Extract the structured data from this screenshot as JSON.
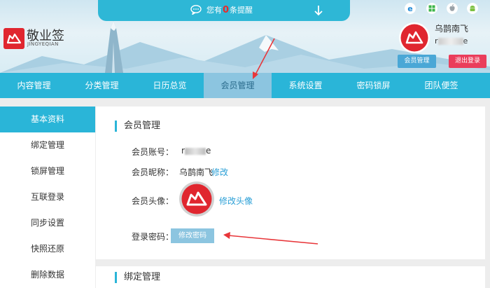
{
  "notification": {
    "prefix": "您有",
    "count": "0",
    "suffix": "条提醒"
  },
  "brand": {
    "name": "敬业签",
    "subtitle": "JINGYEQIAN"
  },
  "platforms": [
    "ie-icon",
    "windows-icon",
    "apple-icon",
    "android-icon"
  ],
  "user": {
    "nickname": "乌鹊南飞",
    "account_suffix": "e",
    "member_button": "会员管理",
    "logout_button": "退出登录"
  },
  "nav": {
    "items": [
      {
        "label": "内容管理"
      },
      {
        "label": "分类管理"
      },
      {
        "label": "日历总览"
      },
      {
        "label": "会员管理"
      },
      {
        "label": "系统设置"
      },
      {
        "label": "密码锁屏"
      },
      {
        "label": "团队便签"
      }
    ]
  },
  "sidebar": {
    "items": [
      {
        "label": "基本资料"
      },
      {
        "label": "绑定管理"
      },
      {
        "label": "锁屏管理"
      },
      {
        "label": "互联登录"
      },
      {
        "label": "同步设置"
      },
      {
        "label": "快照还原"
      },
      {
        "label": "删除数据"
      }
    ]
  },
  "main": {
    "section_title": "会员管理",
    "account_label": "会员账号：",
    "account_prefix": "r",
    "account_suffix": "e",
    "nickname_label": "会员昵称：",
    "nickname_value": "乌鹊南飞",
    "edit_nickname": "修改",
    "avatar_label": "会员头像：",
    "edit_avatar": "修改头像",
    "password_label": "登录密码：",
    "edit_password": "修改密码",
    "section2_title": "绑定管理"
  },
  "colors": {
    "primary": "#2ab5d8",
    "active_nav": "#8cc5e0",
    "logout": "#ea3d5b",
    "brand_red": "#e0262f",
    "arrow": "#e8363a"
  }
}
